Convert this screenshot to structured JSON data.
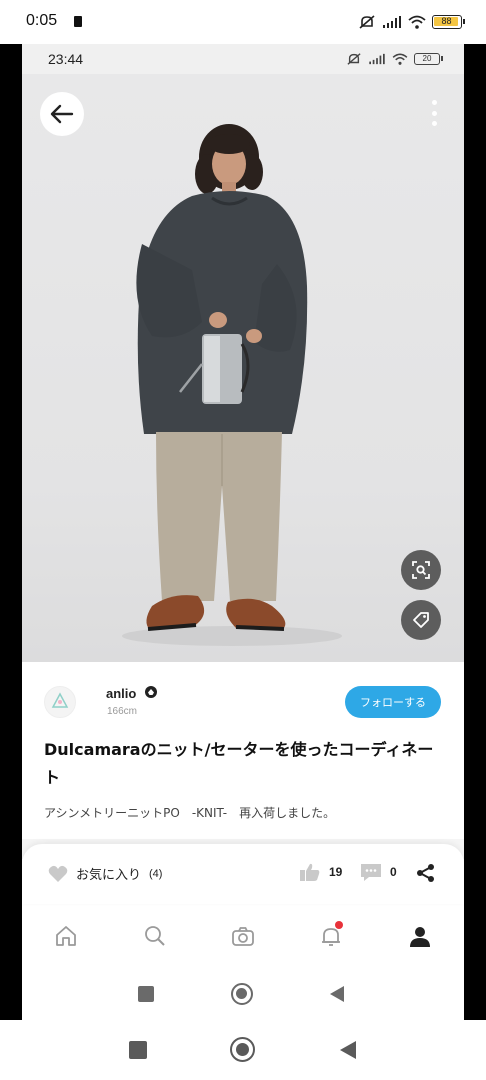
{
  "outer_status": {
    "time": "0:05",
    "battery": "88"
  },
  "inner_status": {
    "time": "23:44",
    "battery": "20"
  },
  "user": {
    "name": "anlio",
    "height": "166cm",
    "follow_label": "フォローする"
  },
  "post": {
    "title": "Dulcamaraのニット/セーターを使ったコーディネート",
    "caption": "アシンメトリーニットPO　-KNIT-　再入荷しました。"
  },
  "actions": {
    "favorite_label": "お気に入り",
    "favorite_count": "(4)",
    "like_count": "19",
    "comment_count": "0"
  },
  "tabs": [
    "home",
    "search",
    "post",
    "notifications",
    "mypage"
  ],
  "colors": {
    "accent": "#2ea8e6",
    "notification_dot": "#e8323a"
  }
}
